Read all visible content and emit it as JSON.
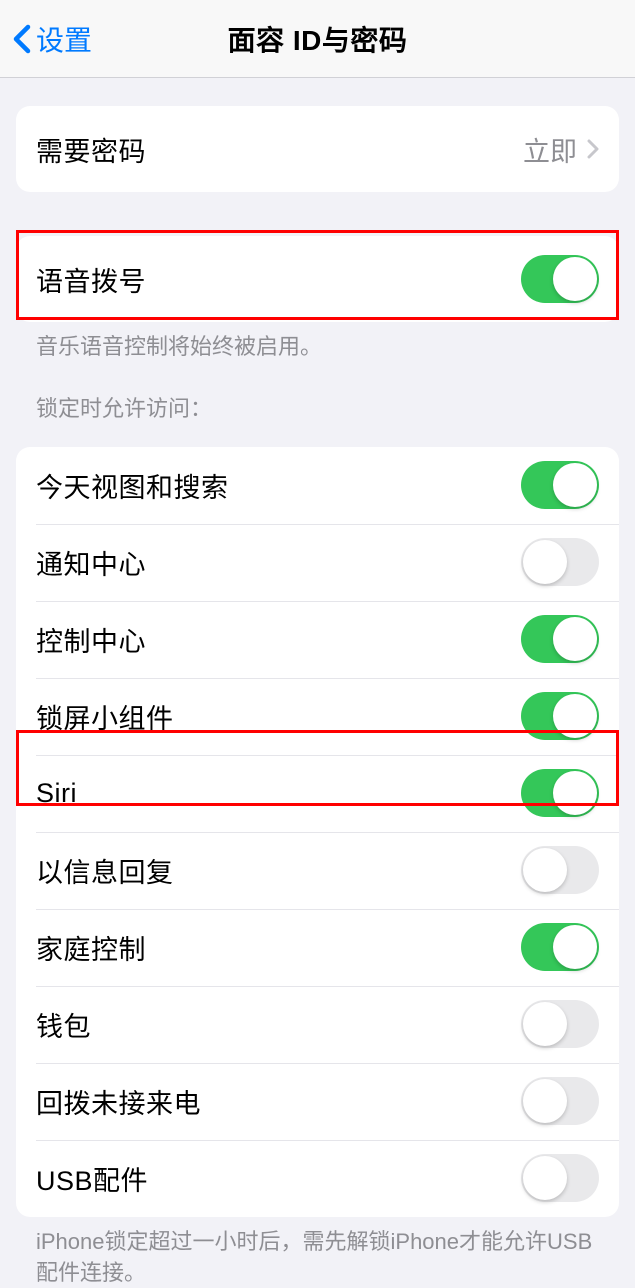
{
  "nav": {
    "back": "设置",
    "title": "面容 ID与密码"
  },
  "group1": {
    "require_passcode": "需要密码",
    "require_passcode_value": "立即"
  },
  "group2": {
    "voice_dial": "语音拨号",
    "voice_dial_footer": "音乐语音控制将始终被启用。"
  },
  "group3": {
    "header": "锁定时允许访问：",
    "today_search": "今天视图和搜索",
    "notification_center": "通知中心",
    "control_center": "控制中心",
    "lock_widgets": "锁屏小组件",
    "siri": "Siri",
    "reply_message": "以信息回复",
    "home_control": "家庭控制",
    "wallet": "钱包",
    "return_missed": "回拨未接来电",
    "usb": "USB配件",
    "usb_footer": "iPhone锁定超过一小时后，需先解锁iPhone才能允许USB 配件连接。"
  }
}
